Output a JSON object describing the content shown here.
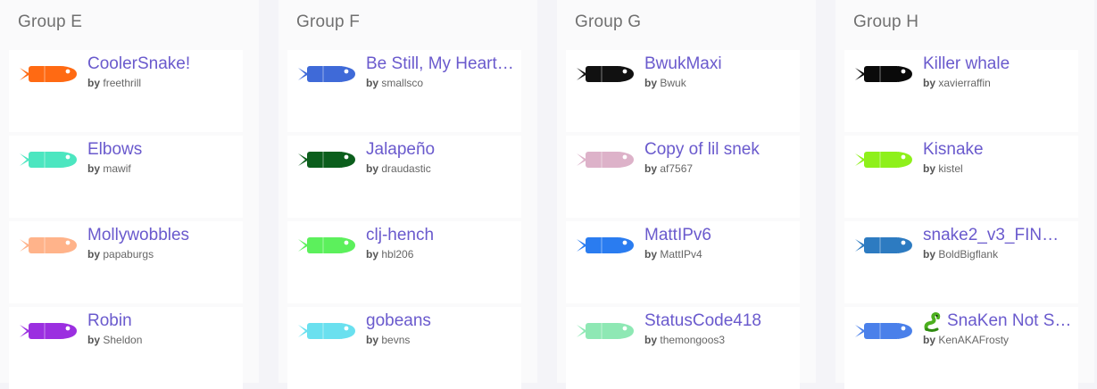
{
  "by_label": "by",
  "groups": [
    {
      "title": "Group E",
      "snakes": [
        {
          "name": "CoolerSnake!",
          "author": "freethrill",
          "color": "#ff6a13"
        },
        {
          "name": "Elbows",
          "author": "mawif",
          "color": "#4ce6c0"
        },
        {
          "name": "Mollywobbles",
          "author": "papaburgs",
          "color": "#ffb38a"
        },
        {
          "name": "Robin",
          "author": "Sheldon",
          "color": "#9b2fe0"
        }
      ]
    },
    {
      "title": "Group F",
      "snakes": [
        {
          "name": "Be Still, My Heart…",
          "author": "smallsco",
          "color": "#3f6ad8"
        },
        {
          "name": "Jalapeño",
          "author": "draudastic",
          "color": "#0b5e1c"
        },
        {
          "name": "clj-hench",
          "author": "hbl206",
          "color": "#5cf05c"
        },
        {
          "name": "gobeans",
          "author": "bevns",
          "color": "#6ae0ef"
        }
      ]
    },
    {
      "title": "Group G",
      "snakes": [
        {
          "name": "BwukMaxi",
          "author": "Bwuk",
          "color": "#111111"
        },
        {
          "name": "Copy of lil snek",
          "author": "af7567",
          "color": "#ddb2c9"
        },
        {
          "name": "MattIPv6",
          "author": "MattIPv4",
          "color": "#2a7cf0"
        },
        {
          "name": "StatusCode418",
          "author": "themongoos3",
          "color": "#8ee8b4"
        }
      ]
    },
    {
      "title": "Group H",
      "snakes": [
        {
          "name": "Killer whale",
          "author": "xavierraffin",
          "color": "#0a0a0a"
        },
        {
          "name": "Kisnake",
          "author": "kistel",
          "color": "#8ef01a"
        },
        {
          "name": "snake2_v3_FIN…",
          "author": "BoldBigflank",
          "color": "#2d7bc1"
        },
        {
          "name": "SnaKen Not S…",
          "author": "KenAKAFrosty",
          "color": "#4a80ea",
          "emoji": "snake-emoji-icon"
        }
      ]
    }
  ]
}
